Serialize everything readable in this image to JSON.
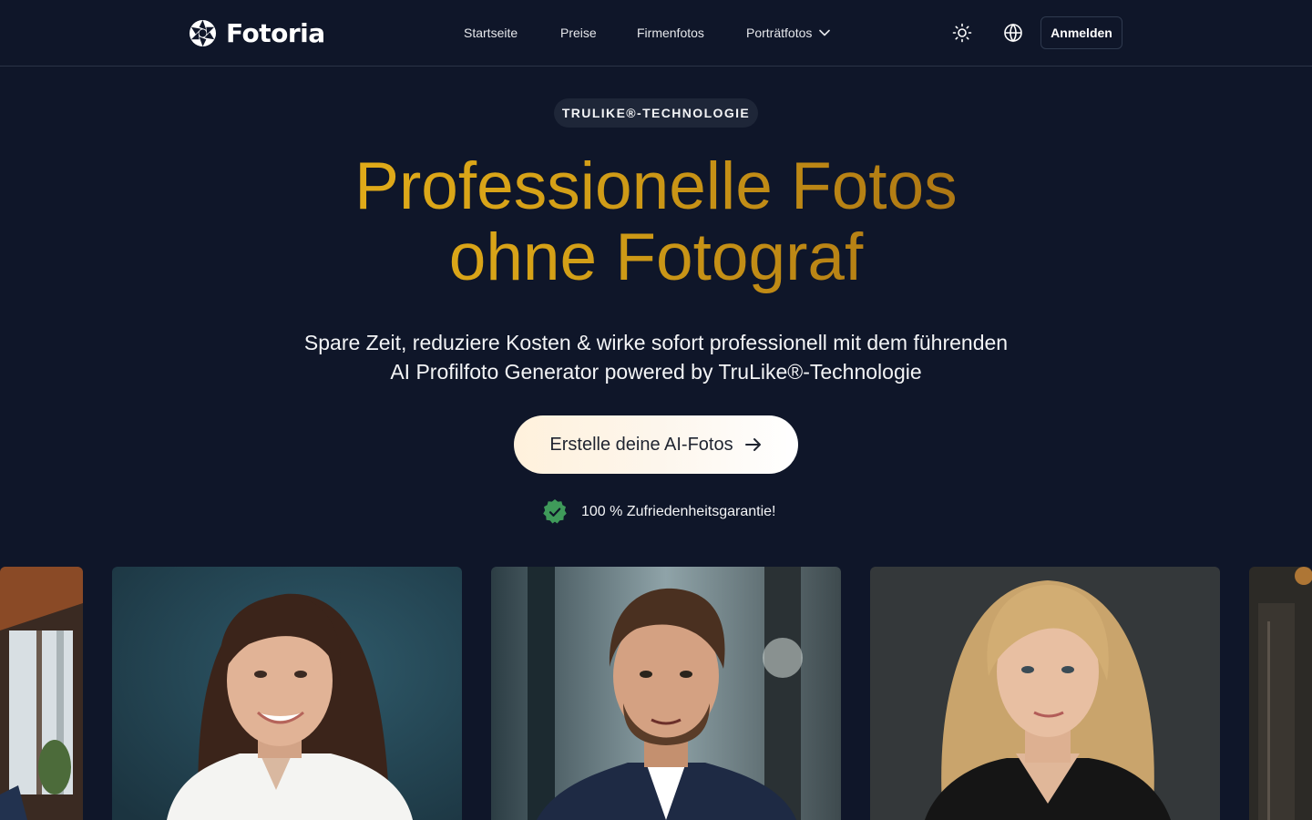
{
  "brand": {
    "name": "Fotoria"
  },
  "nav": {
    "links": [
      "Startseite",
      "Preise",
      "Firmenfotos",
      "Porträtfotos"
    ],
    "theme_icon": "sun-icon",
    "language_icon": "globe-icon",
    "login_label": "Anmelden"
  },
  "hero": {
    "badge": "TRULIKE®-TECHNOLOGIE",
    "headline_line1": "Professionelle Fotos",
    "headline_line2": "ohne Fotograf",
    "subtitle_line1": "Spare Zeit, reduziere Kosten & wirke sofort professionell mit dem führenden",
    "subtitle_line2": "AI Profilfoto Generator powered by TruLike®-Technologie",
    "cta_label": "Erstelle deine AI-Fotos",
    "guarantee": "100 % Zufriedenheitsgarantie!"
  },
  "colors": {
    "background": "#0f1629",
    "headline_gold": "#d4a017",
    "guarantee_green": "#3f9a5a"
  }
}
